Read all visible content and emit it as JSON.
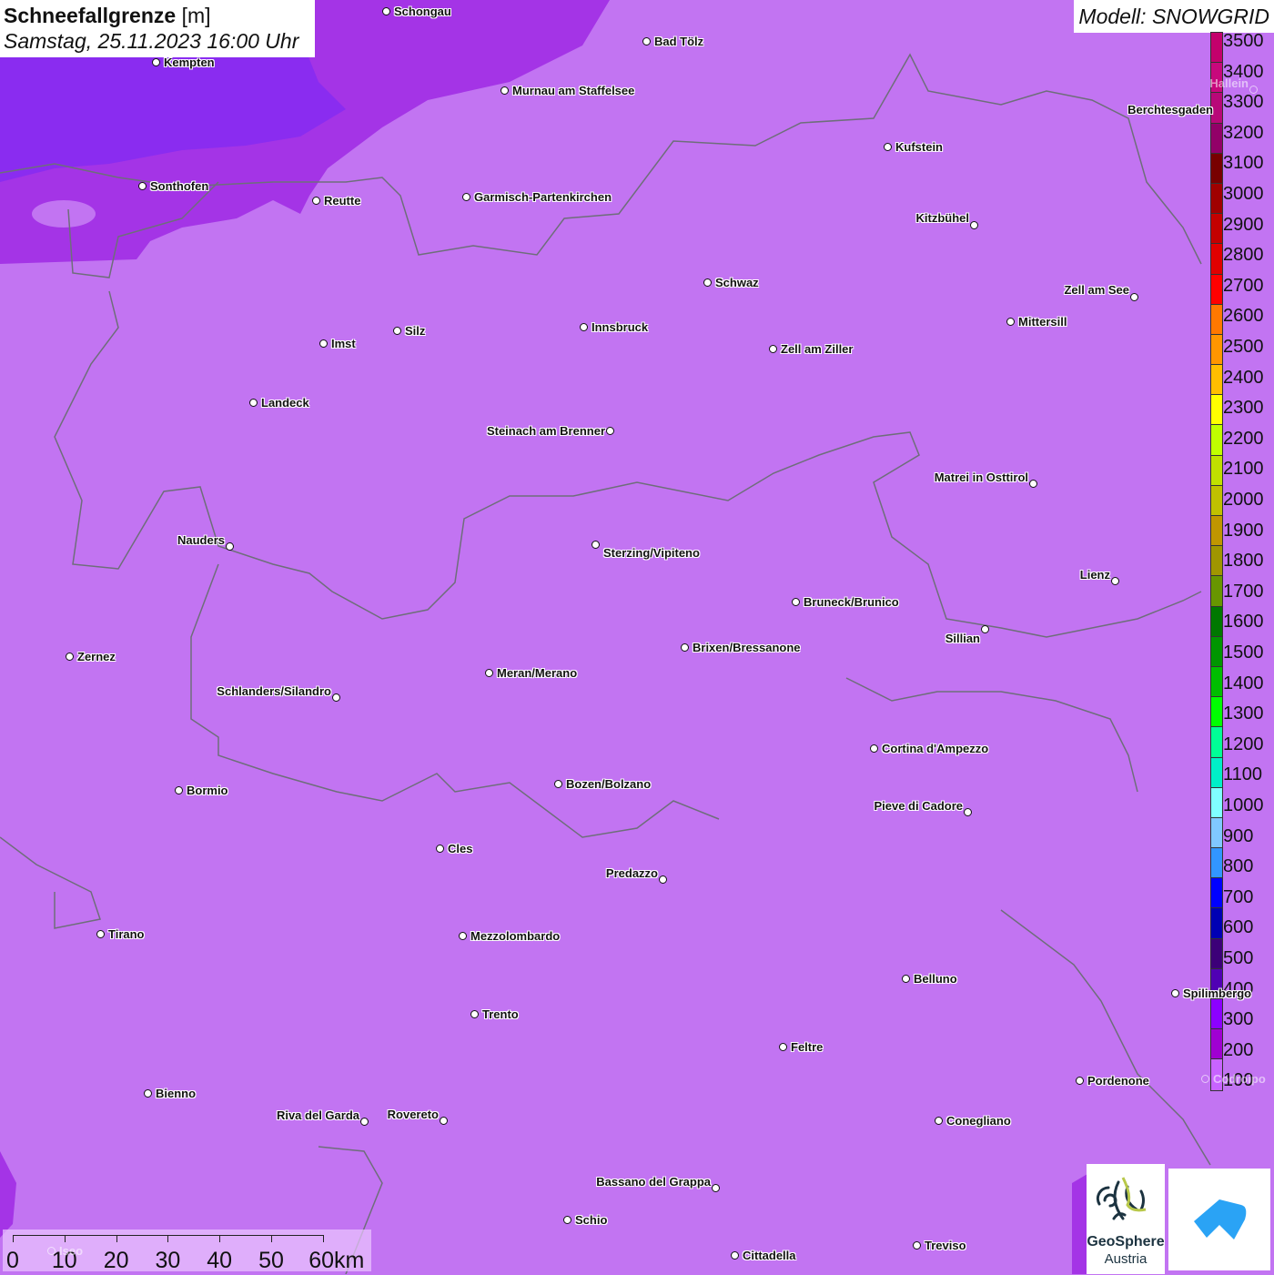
{
  "header": {
    "title": "Schneefallgrenze",
    "unit": "[m]",
    "datetime": "Samstag, 25.11.2023 16:00 Uhr",
    "model": "Modell: SNOWGRID"
  },
  "legend": {
    "labels": [
      "3500",
      "3400",
      "3300",
      "3200",
      "3100",
      "3000",
      "2900",
      "2800",
      "2700",
      "2600",
      "2500",
      "2400",
      "2300",
      "2200",
      "2100",
      "2000",
      "1900",
      "1800",
      "1700",
      "1600",
      "1500",
      "1400",
      "1300",
      "1200",
      "1100",
      "1000",
      "900",
      "800",
      "700",
      "600",
      "500",
      "400",
      "300",
      "200",
      "100"
    ],
    "colors": [
      "#c4006c",
      "#c8087c",
      "#b80878",
      "#920068",
      "#780000",
      "#a00000",
      "#c40000",
      "#e00000",
      "#ff0000",
      "#ff7800",
      "#ff9600",
      "#ffbe00",
      "#ffff00",
      "#c0ff00",
      "#c0e000",
      "#c0c000",
      "#c09600",
      "#a09600",
      "#689600",
      "#007800",
      "#009600",
      "#00be00",
      "#00ff00",
      "#00ff96",
      "#00f0c8",
      "#80ffff",
      "#80c8ff",
      "#3296ff",
      "#0000ff",
      "#0000b4",
      "#3c0078",
      "#5000b4",
      "#8c00ff",
      "#a000d2",
      "#c864ff"
    ]
  },
  "scale_bar": {
    "labels": [
      "0",
      "10",
      "20",
      "30",
      "40",
      "50",
      "60km"
    ]
  },
  "logos": {
    "geosphere_line1": "GeoSphere",
    "geosphere_line2": "Austria"
  },
  "map_colors": {
    "base": "#c274f2",
    "band_200": "#a434e6",
    "band_300": "#8a2cf0",
    "border": "#6e6e7a"
  },
  "cities": [
    "Schongau",
    "Bad Tölz",
    "Kempten",
    "Murnau am Staffelsee",
    "Kufstein",
    "Berchtesgaden",
    "Hallein",
    "Sonthofen",
    "Reutte",
    "Garmisch-Partenkirchen",
    "Kitzbühel",
    "Schwaz",
    "Zell am See",
    "Mittersill",
    "Innsbruck",
    "Silz",
    "Imst",
    "Zell am Ziller",
    "Landeck",
    "Steinach am Brenner",
    "Matrei in Osttirol",
    "Nauders",
    "Sterzing/Vipiteno",
    "Lienz",
    "Bruneck/Brunico",
    "Sillian",
    "Brixen/Bressanone",
    "Zernez",
    "Meran/Merano",
    "Schlanders/Silandro",
    "Cortina d'Ampezzo",
    "Bozen/Bolzano",
    "Bormio",
    "Pieve di Cadore",
    "Cles",
    "Predazzo",
    "Tirano",
    "Mezzolombardo",
    "Belluno",
    "Spilimbergo",
    "Trento",
    "Feltre",
    "Pordenone",
    "Codroipo",
    "Bienno",
    "Riva del Garda",
    "Rovereto",
    "Conegliano",
    "Bassano del Grappa",
    "Schio",
    "Treviso",
    "Cittadella",
    "Iseo"
  ]
}
